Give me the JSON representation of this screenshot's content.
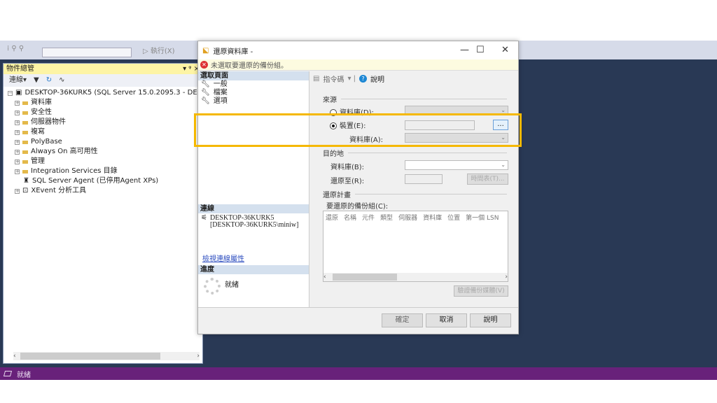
{
  "toolbar": {
    "execute": "▷ 執行(X)"
  },
  "object_explorer": {
    "title": "物件總管",
    "pin": "▾ ᵠ ×",
    "connect": "連線▾",
    "server": "DESKTOP-36KURK5 (SQL Server 15.0.2095.3 - DESKTOP-",
    "nodes": [
      "資料庫",
      "安全性",
      "伺服器物件",
      "複寫",
      "PolyBase",
      "Always On 高可用性",
      "管理",
      "Integration Services 目錄"
    ],
    "agent": "SQL Server Agent (已停用Agent XPs)",
    "xevent": "XEvent 分析工具"
  },
  "dialog": {
    "title": "還原資料庫 -",
    "warning": "未選取要還原的備份組。",
    "select_page": "選取頁面",
    "pages": [
      "一般",
      "檔案",
      "選項"
    ],
    "connection_head": "連線",
    "connection": [
      "DESKTOP-36KURK5",
      "[DESKTOP-36KURK5\\miniw]"
    ],
    "view_conn": "檢視連線屬性",
    "progress_head": "進度",
    "progress": "就緒",
    "script": "指令碼",
    "help": "說明",
    "source": "來源",
    "db_d": "資料庫(D):",
    "device": "裝置(E):",
    "db_a": "資料庫(A):",
    "browse": "...",
    "dest": "目的地",
    "db_b": "資料庫(B):",
    "restore_to": "還原至(R):",
    "timeline": "時間表(T)...",
    "plan": "還原計畫",
    "backup_sets": "要還原的備份組(C):",
    "columns": [
      "還原",
      "名稱",
      "元件",
      "類型",
      "伺服器",
      "資料庫",
      "位置",
      "第一個 LSN"
    ],
    "verify": "驗證備份媒體(V)",
    "ok": "確定",
    "cancel": "取消",
    "help_btn": "說明",
    "source_mode": "device"
  },
  "statusbar": {
    "text": "就緒"
  },
  "colors": {
    "accent_status": "#68217a",
    "highlight": "#f5b800",
    "background": "#293955"
  }
}
